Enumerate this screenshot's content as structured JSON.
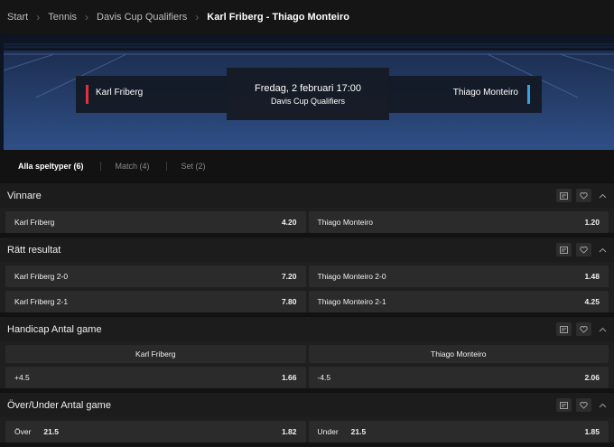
{
  "breadcrumb": [
    "Start",
    "Tennis",
    "Davis Cup Qualifiers",
    "Karl Friberg - Thiago Monteiro"
  ],
  "event": {
    "home": "Karl Friberg",
    "away": "Thiago Monteiro",
    "date": "Fredag, 2 februari 17:00",
    "competition": "Davis Cup Qualifiers",
    "home_color": "#e0313c",
    "away_color": "#2ea6e6"
  },
  "tabs": [
    {
      "label": "Alla speltyper (6)",
      "active": true
    },
    {
      "label": "Match (4)",
      "active": false
    },
    {
      "label": "Set (2)",
      "active": false
    }
  ],
  "markets": {
    "winner": {
      "title": "Vinnare",
      "rows": [
        [
          {
            "label": "Karl Friberg",
            "odd": "4.20"
          },
          {
            "label": "Thiago Monteiro",
            "odd": "1.20"
          }
        ]
      ]
    },
    "correct_score": {
      "title": "Rätt resultat",
      "rows": [
        [
          {
            "label": "Karl Friberg 2-0",
            "odd": "7.20"
          },
          {
            "label": "Thiago Monteiro 2-0",
            "odd": "1.48"
          }
        ],
        [
          {
            "label": "Karl Friberg 2-1",
            "odd": "7.80"
          },
          {
            "label": "Thiago Monteiro 2-1",
            "odd": "4.25"
          }
        ]
      ]
    },
    "handicap": {
      "title": "Handicap Antal game",
      "headers": [
        "Karl Friberg",
        "Thiago Monteiro"
      ],
      "rows": [
        [
          {
            "label": "+4.5",
            "odd": "1.66"
          },
          {
            "label": "-4.5",
            "odd": "2.06"
          }
        ]
      ]
    },
    "over_under": {
      "title": "Över/Under Antal game",
      "rows": [
        [
          {
            "label": "Över",
            "line": "21.5",
            "odd": "1.82"
          },
          {
            "label": "Under",
            "line": "21.5",
            "odd": "1.85"
          }
        ]
      ]
    }
  },
  "icons": [
    "statistics-icon",
    "heart-icon",
    "chevron-up-icon",
    "chevron-right-icon"
  ]
}
